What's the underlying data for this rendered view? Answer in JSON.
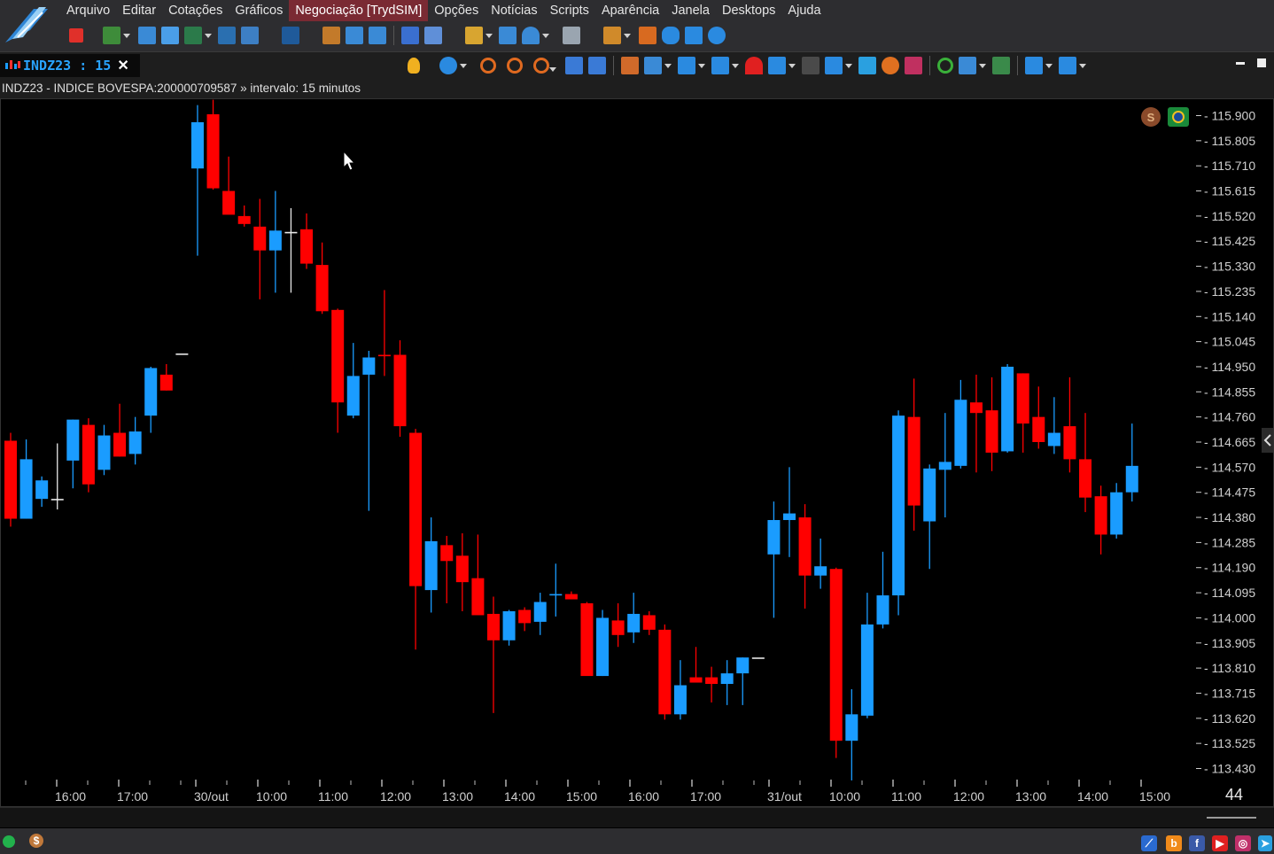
{
  "menu": [
    "Arquivo",
    "Editar",
    "Cotações",
    "Gráficos",
    "Negociação [TrydSIM]",
    "Opções",
    "Notícias",
    "Scripts",
    "Aparência",
    "Janela",
    "Desktops",
    "Ajuda"
  ],
  "active_menu": "Negociação [TrydSIM]",
  "chart_tab": {
    "label": "INDZ23 : 15",
    "close": "✕"
  },
  "info_line": "INDZ23 - INDICE BOVESPA:200000709587 » intervalo: 15 minutos",
  "badge_count": "44",
  "status": {
    "coin_label": "$"
  },
  "colors": {
    "up": "#1a9cff",
    "down": "#ff0000",
    "background": "#000000",
    "axis_text": "#d0d0d0",
    "accent_menu": "#7a2a33"
  },
  "chart_data": {
    "type": "candlestick",
    "title": "",
    "yticks": [
      "115.900",
      "115.805",
      "115.710",
      "115.615",
      "115.520",
      "115.425",
      "115.330",
      "115.235",
      "115.140",
      "115.045",
      "114.950",
      "114.855",
      "114.760",
      "114.665",
      "114.570",
      "114.475",
      "114.380",
      "114.285",
      "114.190",
      "114.095",
      "114.000",
      "113.905",
      "113.810",
      "113.715",
      "113.620",
      "113.525",
      "113.430"
    ],
    "ylim": [
      113430,
      115900
    ],
    "xticks": [
      "16:00",
      "17:00",
      "30/out",
      "10:00",
      "11:00",
      "12:00",
      "13:00",
      "14:00",
      "15:00",
      "16:00",
      "17:00",
      "31/out",
      "10:00",
      "11:00",
      "12:00",
      "13:00",
      "14:00",
      "15:00"
    ],
    "candles": [
      {
        "o": 114670,
        "h": 114700,
        "l": 114345,
        "c": 114375
      },
      {
        "o": 114375,
        "h": 114675,
        "l": 114375,
        "c": 114600
      },
      {
        "o": 114450,
        "h": 114535,
        "l": 114420,
        "c": 114520
      },
      {
        "o": 114450,
        "h": 114660,
        "l": 114410,
        "c": 114450
      },
      {
        "o": 114595,
        "h": 114750,
        "l": 114490,
        "c": 114750
      },
      {
        "o": 114730,
        "h": 114755,
        "l": 114475,
        "c": 114505
      },
      {
        "o": 114560,
        "h": 114730,
        "l": 114540,
        "c": 114690
      },
      {
        "o": 114700,
        "h": 114810,
        "l": 114610,
        "c": 114610
      },
      {
        "o": 114620,
        "h": 114760,
        "l": 114580,
        "c": 114705
      },
      {
        "o": 114765,
        "h": 114950,
        "l": 114700,
        "c": 114945
      },
      {
        "o": 114920,
        "h": 114960,
        "l": 114860,
        "c": 114860
      },
      {
        "o": 115000,
        "h": 115000,
        "l": 115000,
        "c": 115000
      },
      {
        "o": 115700,
        "h": 115940,
        "l": 115370,
        "c": 115875
      },
      {
        "o": 115905,
        "h": 115960,
        "l": 115620,
        "c": 115625
      },
      {
        "o": 115615,
        "h": 115745,
        "l": 115530,
        "c": 115525
      },
      {
        "o": 115520,
        "h": 115560,
        "l": 115480,
        "c": 115490
      },
      {
        "o": 115480,
        "h": 115585,
        "l": 115205,
        "c": 115390
      },
      {
        "o": 115390,
        "h": 115615,
        "l": 115230,
        "c": 115465
      },
      {
        "o": 115460,
        "h": 115550,
        "l": 115230,
        "c": 115460
      },
      {
        "o": 115470,
        "h": 115530,
        "l": 115320,
        "c": 115340
      },
      {
        "o": 115335,
        "h": 115420,
        "l": 115150,
        "c": 115160
      },
      {
        "o": 115165,
        "h": 115170,
        "l": 114700,
        "c": 114815
      },
      {
        "o": 114765,
        "h": 115040,
        "l": 114755,
        "c": 114915
      },
      {
        "o": 114920,
        "h": 115010,
        "l": 114405,
        "c": 114985
      },
      {
        "o": 114995,
        "h": 115240,
        "l": 114915,
        "c": 114990
      },
      {
        "o": 114995,
        "h": 115050,
        "l": 114685,
        "c": 114725
      },
      {
        "o": 114700,
        "h": 114715,
        "l": 113880,
        "c": 114120
      },
      {
        "o": 114105,
        "h": 114380,
        "l": 114020,
        "c": 114290
      },
      {
        "o": 114275,
        "h": 114310,
        "l": 114055,
        "c": 114215
      },
      {
        "o": 114235,
        "h": 114320,
        "l": 114025,
        "c": 114135
      },
      {
        "o": 114150,
        "h": 114315,
        "l": 114020,
        "c": 114010
      },
      {
        "o": 114015,
        "h": 114080,
        "l": 113640,
        "c": 113915
      },
      {
        "o": 113915,
        "h": 114030,
        "l": 113895,
        "c": 114025
      },
      {
        "o": 114030,
        "h": 114040,
        "l": 113950,
        "c": 113980
      },
      {
        "o": 113985,
        "h": 114095,
        "l": 113935,
        "c": 114060
      },
      {
        "o": 114085,
        "h": 114205,
        "l": 114005,
        "c": 114090
      },
      {
        "o": 114090,
        "h": 114100,
        "l": 114070,
        "c": 114070
      },
      {
        "o": 114055,
        "h": 114060,
        "l": 113790,
        "c": 113780
      },
      {
        "o": 113780,
        "h": 114030,
        "l": 113780,
        "c": 114000
      },
      {
        "o": 113990,
        "h": 114055,
        "l": 113890,
        "c": 113935
      },
      {
        "o": 113945,
        "h": 114095,
        "l": 113905,
        "c": 114015
      },
      {
        "o": 114010,
        "h": 114025,
        "l": 113935,
        "c": 113955
      },
      {
        "o": 113955,
        "h": 113975,
        "l": 113615,
        "c": 113635
      },
      {
        "o": 113635,
        "h": 113840,
        "l": 113615,
        "c": 113745
      },
      {
        "o": 113775,
        "h": 113890,
        "l": 113765,
        "c": 113755
      },
      {
        "o": 113775,
        "h": 113815,
        "l": 113680,
        "c": 113750
      },
      {
        "o": 113750,
        "h": 113840,
        "l": 113670,
        "c": 113790
      },
      {
        "o": 113790,
        "h": 113850,
        "l": 113670,
        "c": 113850
      },
      {
        "o": 113850,
        "h": 113850,
        "l": 113850,
        "c": 113850
      },
      {
        "o": 114240,
        "h": 114440,
        "l": 114000,
        "c": 114370
      },
      {
        "o": 114370,
        "h": 114570,
        "l": 114230,
        "c": 114395
      },
      {
        "o": 114380,
        "h": 114430,
        "l": 114035,
        "c": 114160
      },
      {
        "o": 114160,
        "h": 114300,
        "l": 114110,
        "c": 114195
      },
      {
        "o": 114185,
        "h": 114190,
        "l": 113470,
        "c": 113535
      },
      {
        "o": 113535,
        "h": 113730,
        "l": 113385,
        "c": 113635
      },
      {
        "o": 113630,
        "h": 114095,
        "l": 113620,
        "c": 113975
      },
      {
        "o": 113975,
        "h": 114250,
        "l": 113960,
        "c": 114085
      },
      {
        "o": 114085,
        "h": 114785,
        "l": 114010,
        "c": 114765
      },
      {
        "o": 114760,
        "h": 114905,
        "l": 114330,
        "c": 114425
      },
      {
        "o": 114365,
        "h": 114580,
        "l": 114185,
        "c": 114565
      },
      {
        "o": 114560,
        "h": 114775,
        "l": 114380,
        "c": 114590
      },
      {
        "o": 114575,
        "h": 114900,
        "l": 114565,
        "c": 114825
      },
      {
        "o": 114815,
        "h": 114920,
        "l": 114550,
        "c": 114775
      },
      {
        "o": 114785,
        "h": 114910,
        "l": 114555,
        "c": 114625
      },
      {
        "o": 114630,
        "h": 114960,
        "l": 114625,
        "c": 114950
      },
      {
        "o": 114925,
        "h": 114925,
        "l": 114625,
        "c": 114735
      },
      {
        "o": 114760,
        "h": 114875,
        "l": 114640,
        "c": 114665
      },
      {
        "o": 114650,
        "h": 114835,
        "l": 114620,
        "c": 114700
      },
      {
        "o": 114725,
        "h": 114910,
        "l": 114550,
        "c": 114600
      },
      {
        "o": 114600,
        "h": 114775,
        "l": 114400,
        "c": 114455
      },
      {
        "o": 114460,
        "h": 114500,
        "l": 114240,
        "c": 114315
      },
      {
        "o": 114315,
        "h": 114510,
        "l": 114300,
        "c": 114475
      },
      {
        "o": 114475,
        "h": 114735,
        "l": 114440,
        "c": 114575
      }
    ]
  }
}
